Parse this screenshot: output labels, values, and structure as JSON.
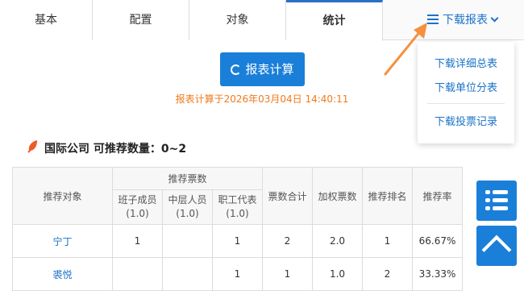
{
  "tabs": [
    {
      "label": "基本"
    },
    {
      "label": "配置"
    },
    {
      "label": "对象"
    },
    {
      "label": "统计",
      "active": true
    }
  ],
  "download": {
    "label": "下载报表",
    "items": [
      "下载详细总表",
      "下载单位分表",
      "下载投票记录"
    ]
  },
  "calc": {
    "button_label": "报表计算",
    "time_text": "报表计算于2026年03月04日 14:40:11"
  },
  "section": {
    "title": "国际公司 可推荐数量：0~2"
  },
  "table": {
    "headers": {
      "target": "推荐对象",
      "votes_group": "推荐票数",
      "sub": [
        {
          "line1": "班子成员",
          "line2": "(1.0)"
        },
        {
          "line1": "中层人员",
          "line2": "(1.0)"
        },
        {
          "line1": "职工代表",
          "line2": "(1.0)"
        }
      ],
      "total": "票数合计",
      "weighted": "加权票数",
      "rank": "推荐排名",
      "rate": "推荐率"
    },
    "rows": [
      {
        "name": "宁丁",
        "c1": "1",
        "c2": "",
        "c3": "1",
        "total": "2",
        "weighted": "2.0",
        "rank": "1",
        "rate": "66.67%"
      },
      {
        "name": "裘悦",
        "c1": "",
        "c2": "",
        "c3": "1",
        "total": "1",
        "weighted": "1.0",
        "rank": "2",
        "rate": "33.33%"
      }
    ]
  },
  "colors": {
    "accent": "#1a7fd9",
    "link": "#1a73c8",
    "time_text": "#f07a1b",
    "arrow": "#f5913e",
    "leaf": "#f05a28"
  },
  "icons": {
    "download_menu": "hamburger-icon",
    "download_chevron": "chevron-down-icon",
    "calc": "refresh-icon",
    "section": "leaf-icon",
    "side_top": "list-icon",
    "side_bottom": "chevron-up-icon"
  }
}
